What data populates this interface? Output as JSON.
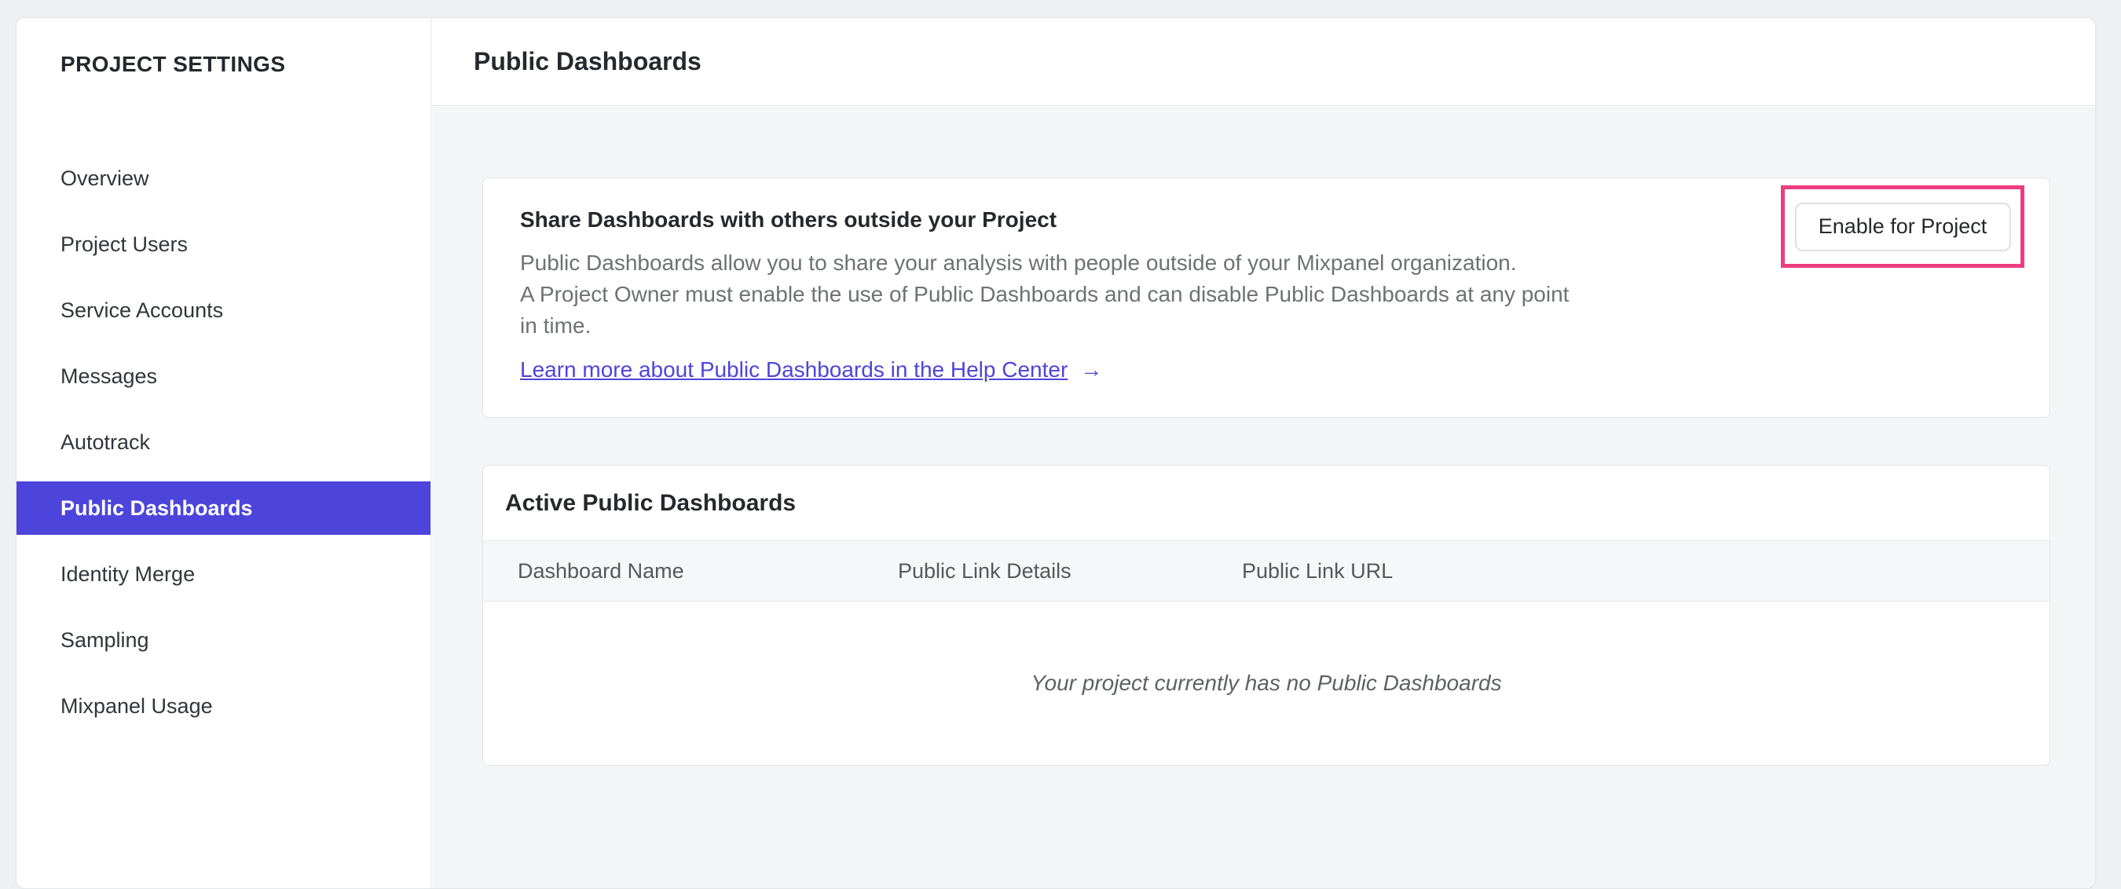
{
  "sidebar": {
    "title": "PROJECT SETTINGS",
    "items": [
      {
        "label": "Overview",
        "selected": false
      },
      {
        "label": "Project Users",
        "selected": false
      },
      {
        "label": "Service Accounts",
        "selected": false
      },
      {
        "label": "Messages",
        "selected": false
      },
      {
        "label": "Autotrack",
        "selected": false
      },
      {
        "label": "Public Dashboards",
        "selected": true
      },
      {
        "label": "Identity Merge",
        "selected": false
      },
      {
        "label": "Sampling",
        "selected": false
      },
      {
        "label": "Mixpanel Usage",
        "selected": false
      }
    ]
  },
  "header": {
    "title": "Public Dashboards"
  },
  "share_card": {
    "heading": "Share Dashboards with others outside your Project",
    "lines": [
      "Public Dashboards allow you to share your analysis with people outside of your Mixpanel organization.",
      "A Project Owner must enable the use of Public Dashboards and can disable Public Dashboards at any point",
      "in time."
    ],
    "link_label": "Learn more about Public Dashboards in the Help Center",
    "link_arrow": "→",
    "enable_button_label": "Enable for Project"
  },
  "active_card": {
    "title": "Active Public Dashboards",
    "columns": [
      "Dashboard Name",
      "Public Link Details",
      "Public Link URL"
    ],
    "empty_message": "Your project currently has no Public Dashboards"
  },
  "colors": {
    "accent_purple": "#4d45db",
    "link_purple": "#4f44d9",
    "highlight_pink": "#ee3d7f"
  }
}
